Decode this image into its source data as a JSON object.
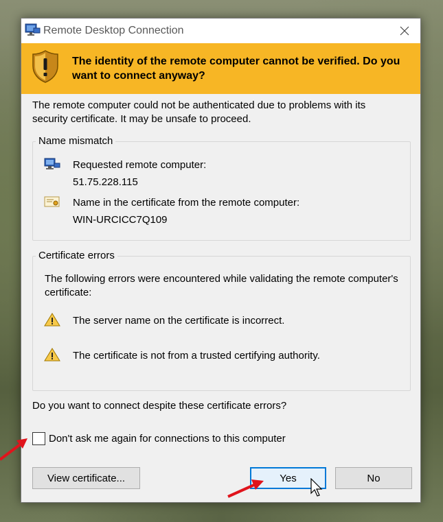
{
  "window": {
    "title": "Remote Desktop Connection",
    "app_icon": "remote-desktop-icon",
    "close_icon": "close-icon"
  },
  "banner": {
    "icon": "warning-shield-icon",
    "headline": "The identity of the remote computer cannot be verified. Do you want to connect anyway?",
    "color": "#f7b625"
  },
  "intro": "The remote computer could not be authenticated due to problems with its security certificate. It may be unsafe to proceed.",
  "name_mismatch": {
    "legend": "Name mismatch",
    "requested_label": "Requested remote computer:",
    "requested_value": "51.75.228.115",
    "cert_label": "Name in the certificate from the remote computer:",
    "cert_value": "WIN-URCICC7Q109"
  },
  "certificate_errors": {
    "legend": "Certificate errors",
    "intro": "The following errors were encountered while validating the remote computer's certificate:",
    "errors": [
      "The server name on the certificate is incorrect.",
      "The certificate is not from a trusted certifying authority."
    ]
  },
  "question": "Do you want to connect despite these certificate errors?",
  "dont_ask": {
    "label": "Don't ask me again for connections to this computer",
    "checked": false
  },
  "buttons": {
    "view_certificate": "View certificate...",
    "yes": "Yes",
    "no": "No"
  },
  "colors": {
    "focus_border": "#0078d7",
    "annotation_arrow": "#e0141c"
  }
}
